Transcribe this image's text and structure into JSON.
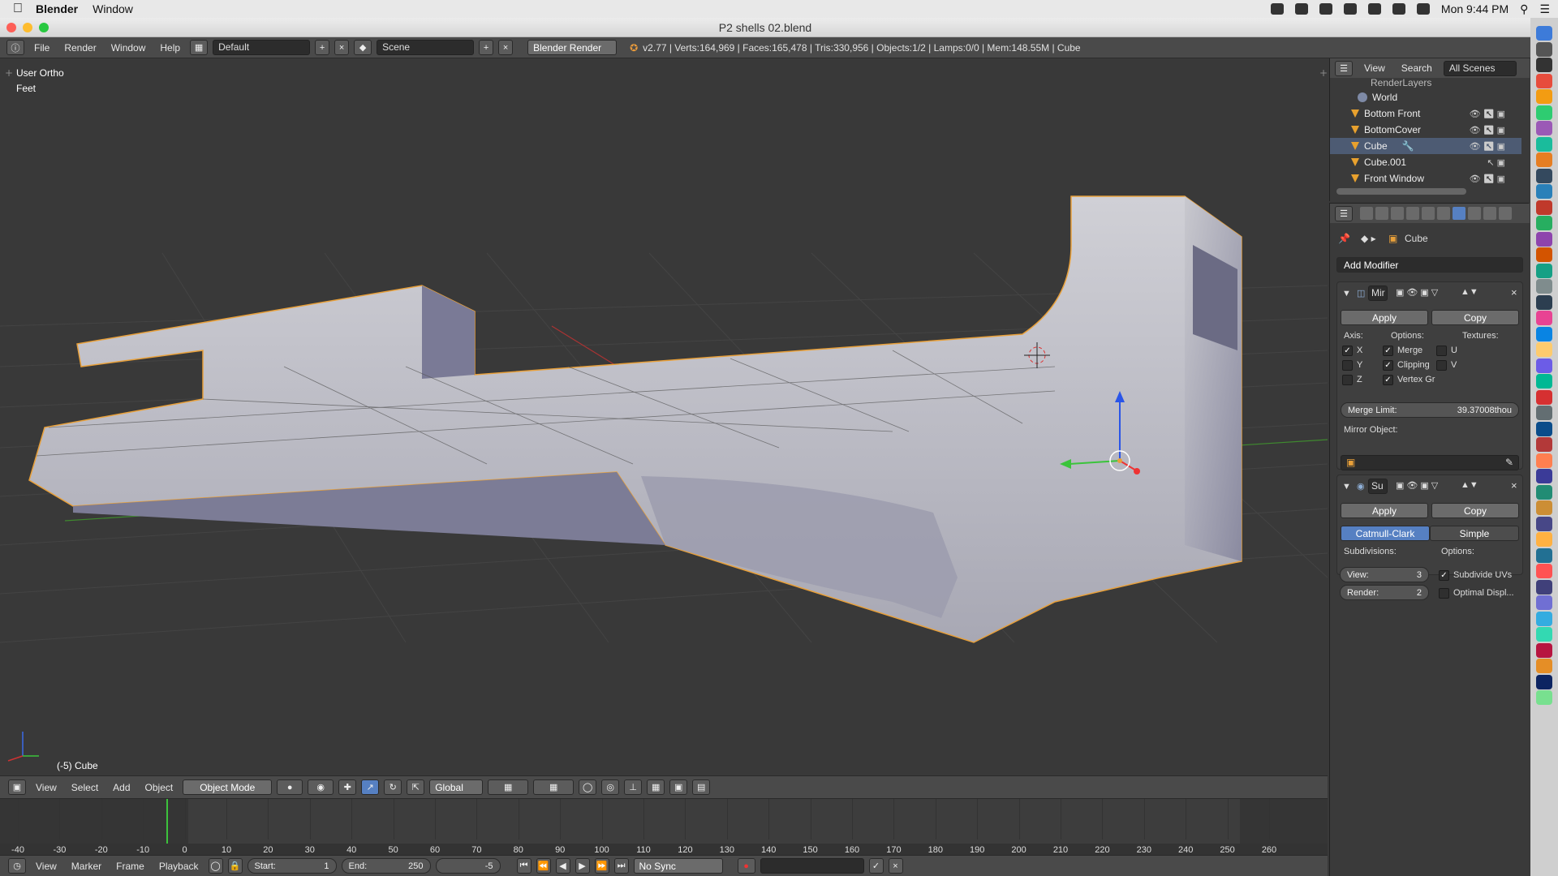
{
  "macmenu": {
    "app": "Blender",
    "window": "Window",
    "clock": "Mon 9:44 PM"
  },
  "window_title": "P2 shells 02.blend",
  "infobar": {
    "menus": [
      "File",
      "Render",
      "Window",
      "Help"
    ],
    "layout": "Default",
    "scene": "Scene",
    "engine": "Blender Render",
    "stats": "v2.77 | Verts:164,969 | Faces:165,478 | Tris:330,956 | Objects:1/2 | Lamps:0/0 | Mem:148.55M | Cube"
  },
  "viewport": {
    "view_name": "User Ortho",
    "units": "Feet",
    "object_label": "(-5) Cube"
  },
  "view3d_header": {
    "menus": [
      "View",
      "Select",
      "Add",
      "Object"
    ],
    "mode": "Object Mode",
    "orientation": "Global"
  },
  "timeline": {
    "ticks": [
      "-40",
      "-30",
      "-20",
      "-10",
      "0",
      "10",
      "20",
      "30",
      "40",
      "50",
      "60",
      "70",
      "80",
      "90",
      "100",
      "110",
      "120",
      "130",
      "140",
      "150",
      "160",
      "170",
      "180",
      "190",
      "200",
      "210",
      "220",
      "230",
      "240",
      "250",
      "260"
    ],
    "menus": [
      "View",
      "Marker",
      "Frame",
      "Playback"
    ],
    "start_label": "Start:",
    "start": "1",
    "end_label": "End:",
    "end": "250",
    "current": "-5",
    "sync": "No Sync"
  },
  "outliner": {
    "menus": [
      "View",
      "Search"
    ],
    "scope": "All Scenes",
    "items": [
      {
        "label": "RenderLayers"
      },
      {
        "label": "World"
      },
      {
        "label": "Bottom Front"
      },
      {
        "label": "BottomCover"
      },
      {
        "label": "Cube"
      },
      {
        "label": "Cube.001"
      },
      {
        "label": "Front Window"
      }
    ]
  },
  "properties": {
    "context": "Cube",
    "add_modifier": "Add Modifier",
    "mirror": {
      "name": "Mir",
      "apply": "Apply",
      "copy": "Copy",
      "axis_label": "Axis:",
      "options_label": "Options:",
      "textures_label": "Textures:",
      "axis": [
        {
          "label": "X",
          "on": true
        },
        {
          "label": "Y",
          "on": false
        },
        {
          "label": "Z",
          "on": false
        }
      ],
      "options": [
        {
          "label": "Merge",
          "on": true
        },
        {
          "label": "Clipping",
          "on": true
        },
        {
          "label": "Vertex Gr",
          "on": true
        }
      ],
      "textures": [
        {
          "label": "U",
          "on": false
        },
        {
          "label": "V",
          "on": false
        }
      ],
      "merge_limit_label": "Merge Limit:",
      "merge_limit": "39.37008thou",
      "mirror_object_label": "Mirror Object:"
    },
    "subsurf": {
      "name": "Su",
      "apply": "Apply",
      "copy": "Copy",
      "types": [
        "Catmull-Clark",
        "Simple"
      ],
      "subdivisions_label": "Subdivisions:",
      "options_label": "Options:",
      "view_label": "View:",
      "view": "3",
      "render_label": "Render:",
      "render": "2",
      "subdivide_uvs": "Subdivide UVs",
      "subdivide_uvs_on": true,
      "optimal_display": "Optimal Displ...",
      "optimal_display_on": false
    }
  }
}
